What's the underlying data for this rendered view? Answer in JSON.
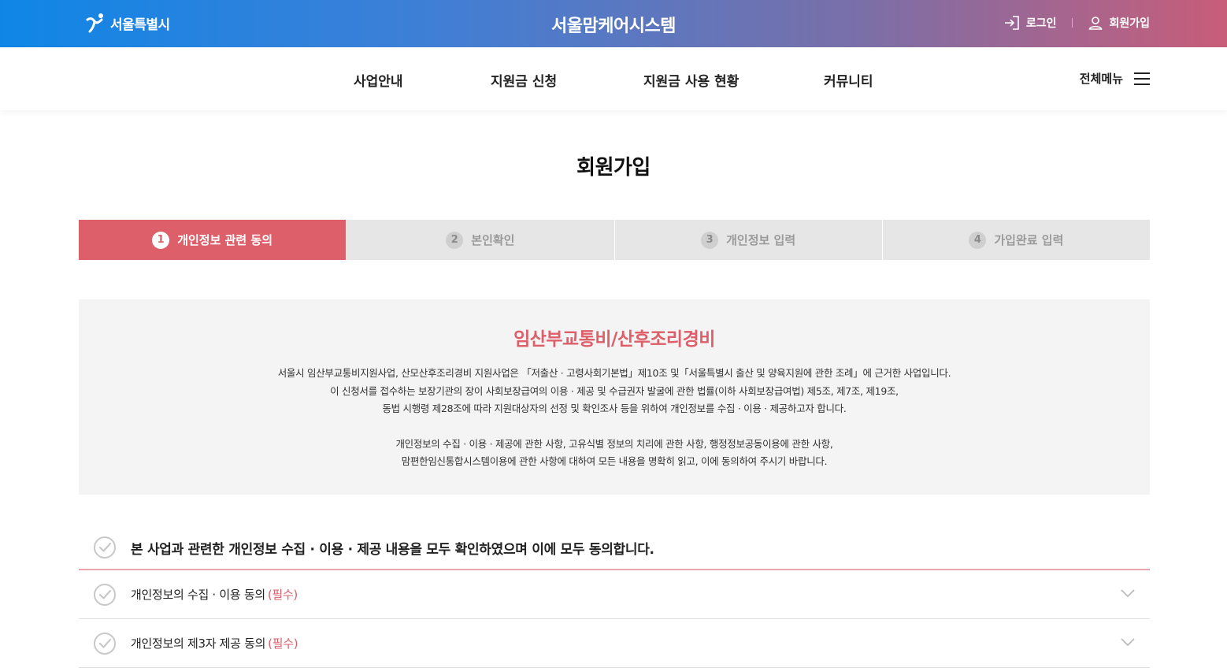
{
  "header": {
    "logo_text": "서울특별시",
    "site_title": "서울맘케어시스템",
    "login_label": "로그인",
    "signup_label": "회원가입"
  },
  "nav": {
    "items": [
      {
        "label": "사업안내"
      },
      {
        "label": "지원금 신청"
      },
      {
        "label": "지원금 사용 현황"
      },
      {
        "label": "커뮤니티"
      }
    ],
    "all_menu_label": "전체메뉴"
  },
  "page": {
    "title": "회원가입"
  },
  "steps": [
    {
      "num": "1",
      "label": "개인정보 관련 동의",
      "active": true
    },
    {
      "num": "2",
      "label": "본인확인",
      "active": false
    },
    {
      "num": "3",
      "label": "개인정보 입력",
      "active": false
    },
    {
      "num": "4",
      "label": "가입완료 입력",
      "active": false
    }
  ],
  "info": {
    "title": "임산부교통비/산후조리경비",
    "para1": [
      "서울시 임산부교통비지원사업, 산모산후조리경비 지원사업은 「저출산 · 고령사회기본법」제10조 및「서울특별시 출산 및 양육지원에 관한 조례」에 근거한 사업입니다.",
      "이 신청서를 접수하는 보장기관의 장이 사회보장급여의 이용 · 제공 및 수급권자 발굴에 관한 법률(이하 사회보장급여법) 제5조, 제7조, 제19조,",
      "동법 시행령 제28조에 따라 지원대상자의 선정 및 확인조사 등을 위하여 개인정보를 수집 · 이용 · 제공하고자 합니다."
    ],
    "para2": [
      "개인정보의 수집 · 이용 · 제공에 관한 사항, 고유식별 정보의 치리에 관한 사항, 행정정보공동이용에 관한 사항,",
      "맘편한임신통합시스템이용에 관한 사항에 대하여 모든 내용을 명확히 읽고, 이에 동의하여 주시기 바랍니다."
    ]
  },
  "agreements": {
    "all_label": "본 사업과 관련한 개인정보 수집 · 이용 · 제공 내용을 모두 확인하였으며 이에 모두 동의합니다.",
    "items": [
      {
        "label": "개인정보의 수집 · 이용 동의",
        "required": "(필수)"
      },
      {
        "label": "개인정보의 제3자 제공 동의",
        "required": "(필수)"
      }
    ]
  },
  "colors": {
    "accent": "#dc5f6a",
    "gradient_start": "#0f86e6",
    "gradient_end": "#c85d79",
    "step_inactive": "#e6e6e6",
    "info_bg": "#f4f4f4"
  }
}
